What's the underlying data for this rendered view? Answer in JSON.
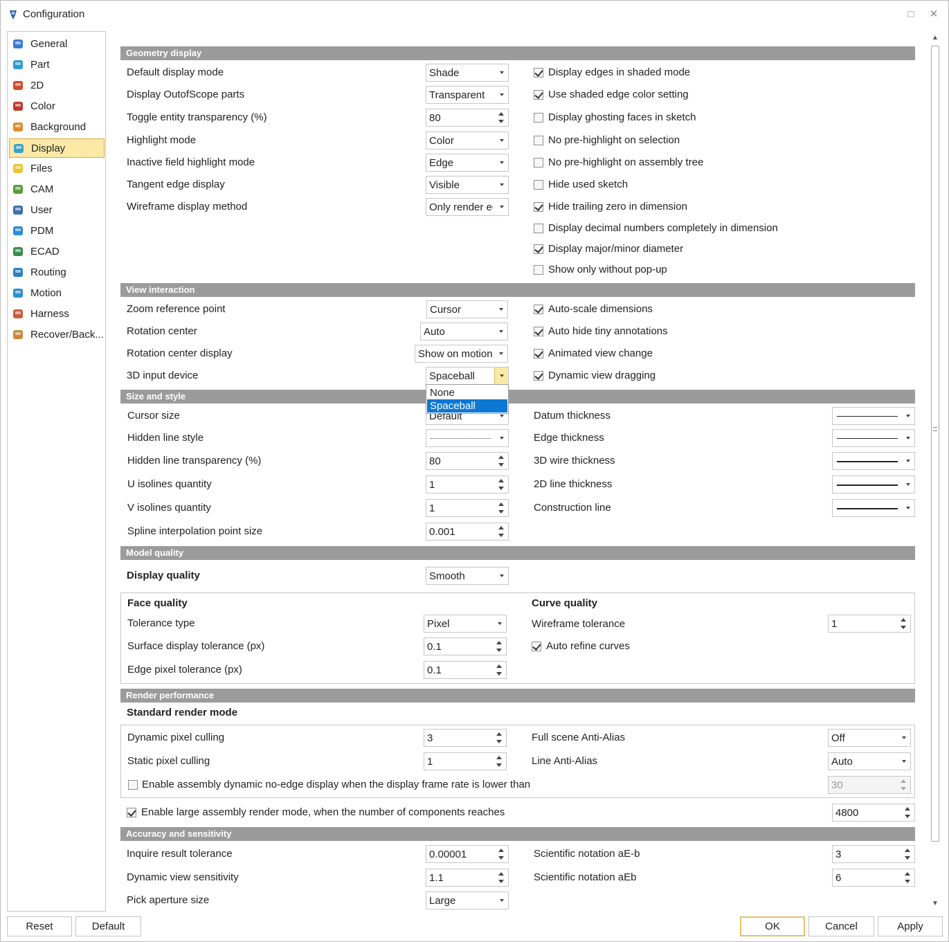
{
  "window": {
    "title": "Configuration"
  },
  "sidebar": {
    "items": [
      {
        "label": "General",
        "icon": "general-icon"
      },
      {
        "label": "Part",
        "icon": "part-icon"
      },
      {
        "label": "2D",
        "icon": "2d-icon"
      },
      {
        "label": "Color",
        "icon": "color-icon"
      },
      {
        "label": "Background",
        "icon": "background-icon"
      },
      {
        "label": "Display",
        "icon": "display-icon",
        "selected": true
      },
      {
        "label": "Files",
        "icon": "folder-icon"
      },
      {
        "label": "CAM",
        "icon": "cam-icon"
      },
      {
        "label": "User",
        "icon": "user-icon"
      },
      {
        "label": "PDM",
        "icon": "pdm-icon"
      },
      {
        "label": "ECAD",
        "icon": "ecad-icon"
      },
      {
        "label": "Routing",
        "icon": "routing-icon"
      },
      {
        "label": "Motion",
        "icon": "motion-icon"
      },
      {
        "label": "Harness",
        "icon": "harness-icon"
      },
      {
        "label": "Recover/Back...",
        "icon": "recover-icon"
      }
    ]
  },
  "geometry": {
    "header": "Geometry display",
    "rows": [
      {
        "label": "Default display mode",
        "value": "Shade"
      },
      {
        "label": "Display OutofScope parts",
        "value": "Transparent"
      },
      {
        "label": "Toggle entity transparency (%)",
        "value": "80"
      },
      {
        "label": "Highlight mode",
        "value": "Color"
      },
      {
        "label": "Inactive field highlight mode",
        "value": "Edge"
      },
      {
        "label": "Tangent edge display",
        "value": "Visible"
      },
      {
        "label": "Wireframe display method",
        "value": "Only render ed"
      }
    ],
    "checks": [
      {
        "label": "Display edges in shaded mode",
        "checked": true
      },
      {
        "label": "Use shaded edge color setting",
        "checked": true
      },
      {
        "label": "Display ghosting faces in sketch",
        "checked": false
      },
      {
        "label": "No pre-highlight on selection",
        "checked": false
      },
      {
        "label": "No pre-highlight on assembly tree",
        "checked": false
      },
      {
        "label": "Hide used sketch",
        "checked": false
      },
      {
        "label": "Hide trailing zero in dimension",
        "checked": true
      },
      {
        "label": "Display decimal numbers completely in dimension",
        "checked": false
      },
      {
        "label": "Display major/minor diameter",
        "checked": true
      },
      {
        "label": "Show only without pop-up",
        "checked": false
      }
    ]
  },
  "view": {
    "header": "View interaction",
    "rows": [
      {
        "label": "Zoom reference point",
        "value": "Cursor"
      },
      {
        "label": "Rotation center",
        "value": "Auto"
      },
      {
        "label": "Rotation center display",
        "value": "Show on motion"
      },
      {
        "label": "3D input device",
        "value": "Spaceball"
      }
    ],
    "checks": [
      {
        "label": "Auto-scale dimensions",
        "checked": true
      },
      {
        "label": "Auto hide tiny annotations",
        "checked": true
      },
      {
        "label": "Animated view change",
        "checked": true
      },
      {
        "label": "Dynamic view dragging",
        "checked": true
      }
    ],
    "dropdown_options": [
      "None",
      "Spaceball"
    ]
  },
  "size": {
    "header": "Size and style",
    "rows": [
      {
        "label": "Cursor size",
        "value": "Default"
      },
      {
        "label": "Hidden line style",
        "value": ""
      },
      {
        "label": "Hidden line transparency (%)",
        "value": "80"
      },
      {
        "label": "U isolines quantity",
        "value": "1"
      },
      {
        "label": "V isolines quantity",
        "value": "1"
      },
      {
        "label": "Spline interpolation point size",
        "value": "0.001"
      }
    ],
    "right": [
      {
        "label": "Datum thickness"
      },
      {
        "label": "Edge thickness"
      },
      {
        "label": "3D wire thickness"
      },
      {
        "label": "2D line thickness"
      },
      {
        "label": "Construction line"
      }
    ]
  },
  "model": {
    "header": "Model quality",
    "display_quality_label": "Display quality",
    "display_quality_value": "Smooth",
    "face_quality": "Face quality",
    "tolerance_type_label": "Tolerance type",
    "tolerance_type_value": "Pixel",
    "surface_tol_label": "Surface display tolerance (px)",
    "surface_tol_value": "0.1",
    "edge_tol_label": "Edge pixel tolerance (px)",
    "edge_tol_value": "0.1",
    "curve_quality": "Curve quality",
    "wireframe_tol_label": "Wireframe tolerance",
    "wireframe_tol_value": "1",
    "auto_refine_label": "Auto refine curves"
  },
  "render": {
    "header": "Render performance",
    "standard_label": "Standard render mode",
    "dyn_cull_label": "Dynamic pixel culling",
    "dyn_cull_value": "3",
    "static_cull_label": "Static pixel culling",
    "static_cull_value": "1",
    "fsaa_label": "Full scene Anti-Alias",
    "fsaa_value": "Off",
    "laa_label": "Line Anti-Alias",
    "laa_value": "Auto",
    "noedge_label": "Enable assembly dynamic no-edge display when the display frame rate is lower than",
    "noedge_value": "30",
    "large_label": "Enable large assembly render mode, when the number of components reaches",
    "large_value": "4800"
  },
  "accuracy": {
    "header": "Accuracy and sensitivity",
    "inquire_label": "Inquire result tolerance",
    "inquire_value": "0.00001",
    "dvs_label": "Dynamic view sensitivity",
    "dvs_value": "1.1",
    "pick_label": "Pick aperture size",
    "pick_value": "Large",
    "sci1_label": "Scientific notation aE-b",
    "sci1_value": "3",
    "sci2_label": "Scientific notation aEb",
    "sci2_value": "6"
  },
  "buttons": {
    "reset": "Reset",
    "default": "Default",
    "ok": "OK",
    "cancel": "Cancel",
    "apply": "Apply"
  }
}
